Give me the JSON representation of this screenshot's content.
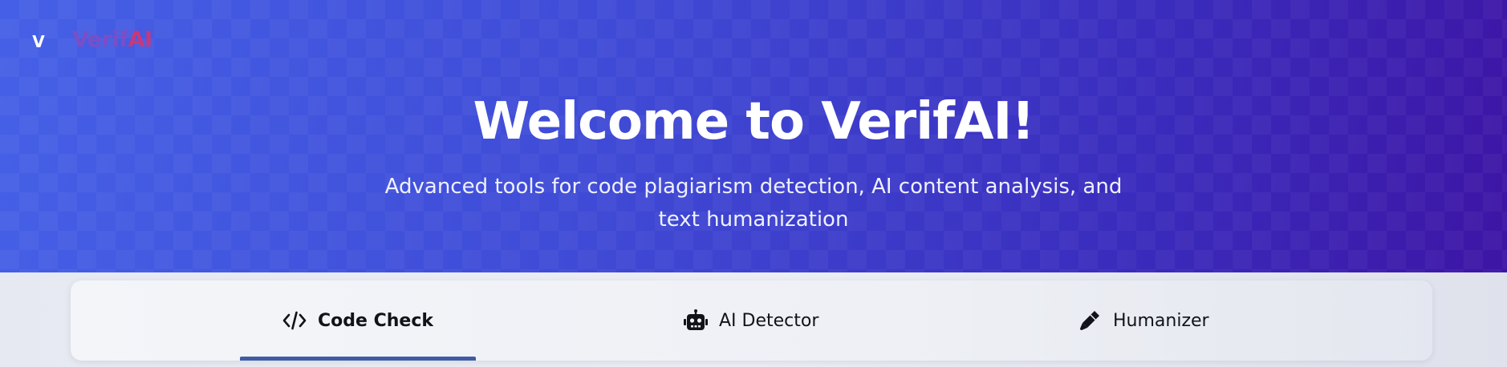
{
  "brand": {
    "badge_letter": "V",
    "name_part1": "Verif",
    "name_part2": "AI",
    "colors": {
      "part1": "#7a4fc6",
      "part2": "#c8387a"
    }
  },
  "hero": {
    "title": "Welcome to VerifAI!",
    "subtitle_line1": "Advanced tools for code plagiarism detection, AI content analysis, and",
    "subtitle_line2": "text humanization",
    "gradient_start": "#4560e6",
    "gradient_end": "#3d15a5"
  },
  "tabs": [
    {
      "label": "Code Check",
      "icon": "code-icon",
      "active": true
    },
    {
      "label": "AI Detector",
      "icon": "robot-icon",
      "active": false
    },
    {
      "label": "Humanizer",
      "icon": "pen-icon",
      "active": false
    }
  ],
  "accent": "#3f5ba3"
}
